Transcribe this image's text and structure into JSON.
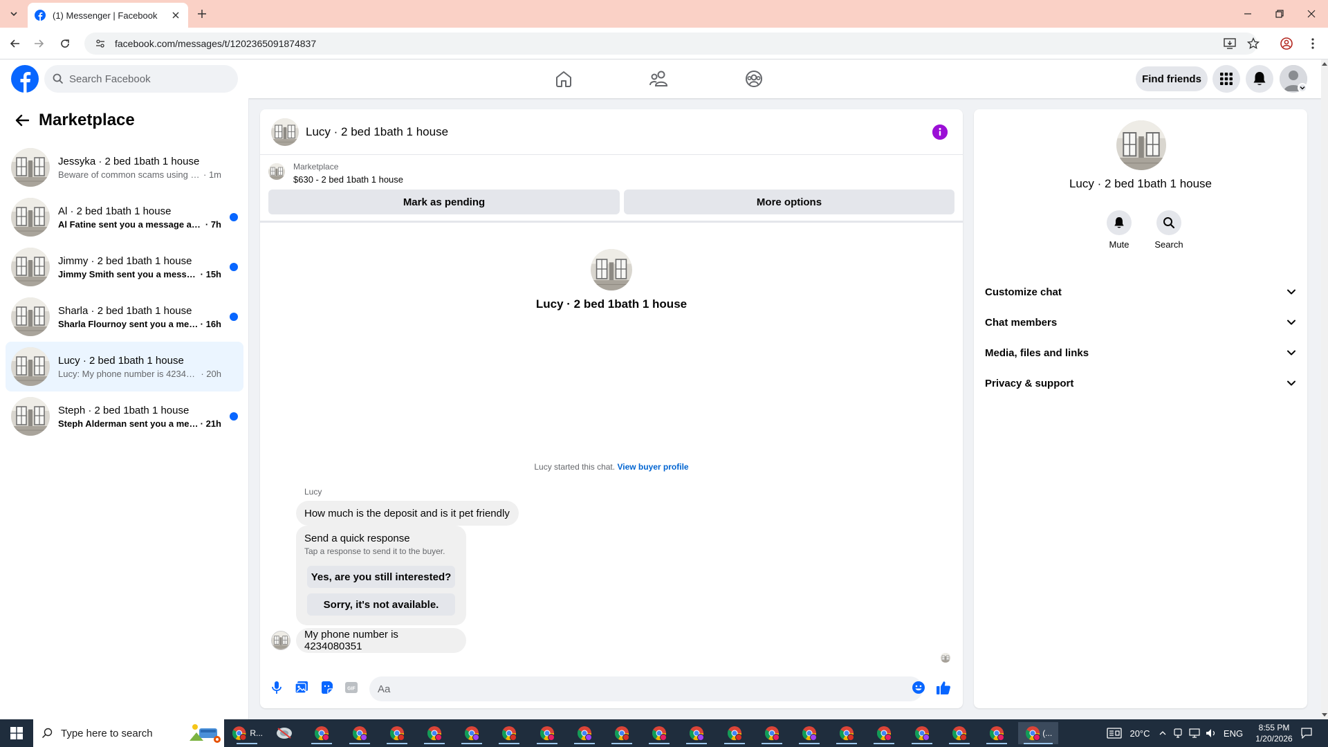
{
  "browser": {
    "tab_title": "(1) Messenger | Facebook",
    "url": "facebook.com/messages/t/1202365091874837"
  },
  "header": {
    "search_placeholder": "Search Facebook",
    "find_friends_label": "Find friends"
  },
  "sidebar": {
    "title": "Marketplace",
    "conversations": [
      {
        "name": "Jessyka · 2 bed 1bath 1 house",
        "preview": "Beware of common scams using pay...",
        "time": "· 1m",
        "unread": false,
        "active": false
      },
      {
        "name": "Al · 2 bed 1bath 1 house",
        "preview": "Al Fatine sent you a message abou...",
        "time": "· 7h",
        "unread": true,
        "active": false
      },
      {
        "name": "Jimmy · 2 bed 1bath 1 house",
        "preview": "Jimmy Smith sent you a message ...",
        "time": "· 15h",
        "unread": true,
        "active": false
      },
      {
        "name": "Sharla · 2 bed 1bath 1 house",
        "preview": "Sharla Flournoy sent you a messa...",
        "time": "· 16h",
        "unread": true,
        "active": false
      },
      {
        "name": "Lucy · 2 bed 1bath 1 house",
        "preview": "Lucy: My phone number is 4234080...",
        "time": "· 20h",
        "unread": false,
        "active": true
      },
      {
        "name": "Steph · 2 bed 1bath 1 house",
        "preview": "Steph Alderman sent you a mess...",
        "time": "· 21h",
        "unread": true,
        "active": false
      }
    ]
  },
  "chat": {
    "title": "Lucy · 2 bed 1bath 1 house",
    "listing_category": "Marketplace",
    "listing_price": "$630 - 2 bed 1bath 1 house",
    "mark_pending_label": "Mark as pending",
    "more_options_label": "More options",
    "intro_title": "Lucy · 2 bed 1bath 1 house",
    "started_text": "Lucy started this chat.",
    "view_buyer_profile": "View buyer profile",
    "sender_name": "Lucy",
    "message_1": "How much is the deposit and is it pet friendly",
    "quick_title": "Send a quick response",
    "quick_subtitle": "Tap a response to send it to the buyer.",
    "quick_reply_1": "Yes, are you still interested?",
    "quick_reply_2": "Sorry, it's not available.",
    "message_2": "My phone number is 4234080351",
    "composer_placeholder": "Aa"
  },
  "details": {
    "title": "Lucy · 2 bed 1bath 1 house",
    "mute_label": "Mute",
    "search_label": "Search",
    "sections": [
      "Customize chat",
      "Chat members",
      "Media, files and links",
      "Privacy & support"
    ]
  },
  "taskbar": {
    "search_placeholder": "Type here to search",
    "first_app_label": "R...",
    "last_app_label": "(...",
    "temperature": "20°C",
    "language": "ENG",
    "time": "8:55 PM",
    "date": "1/20/2026"
  },
  "colors": {
    "fb_blue": "#0866ff",
    "info_purple": "#9b0fd6",
    "tab_bar": "#fad1c6",
    "taskbar": "#1f2d3d"
  }
}
